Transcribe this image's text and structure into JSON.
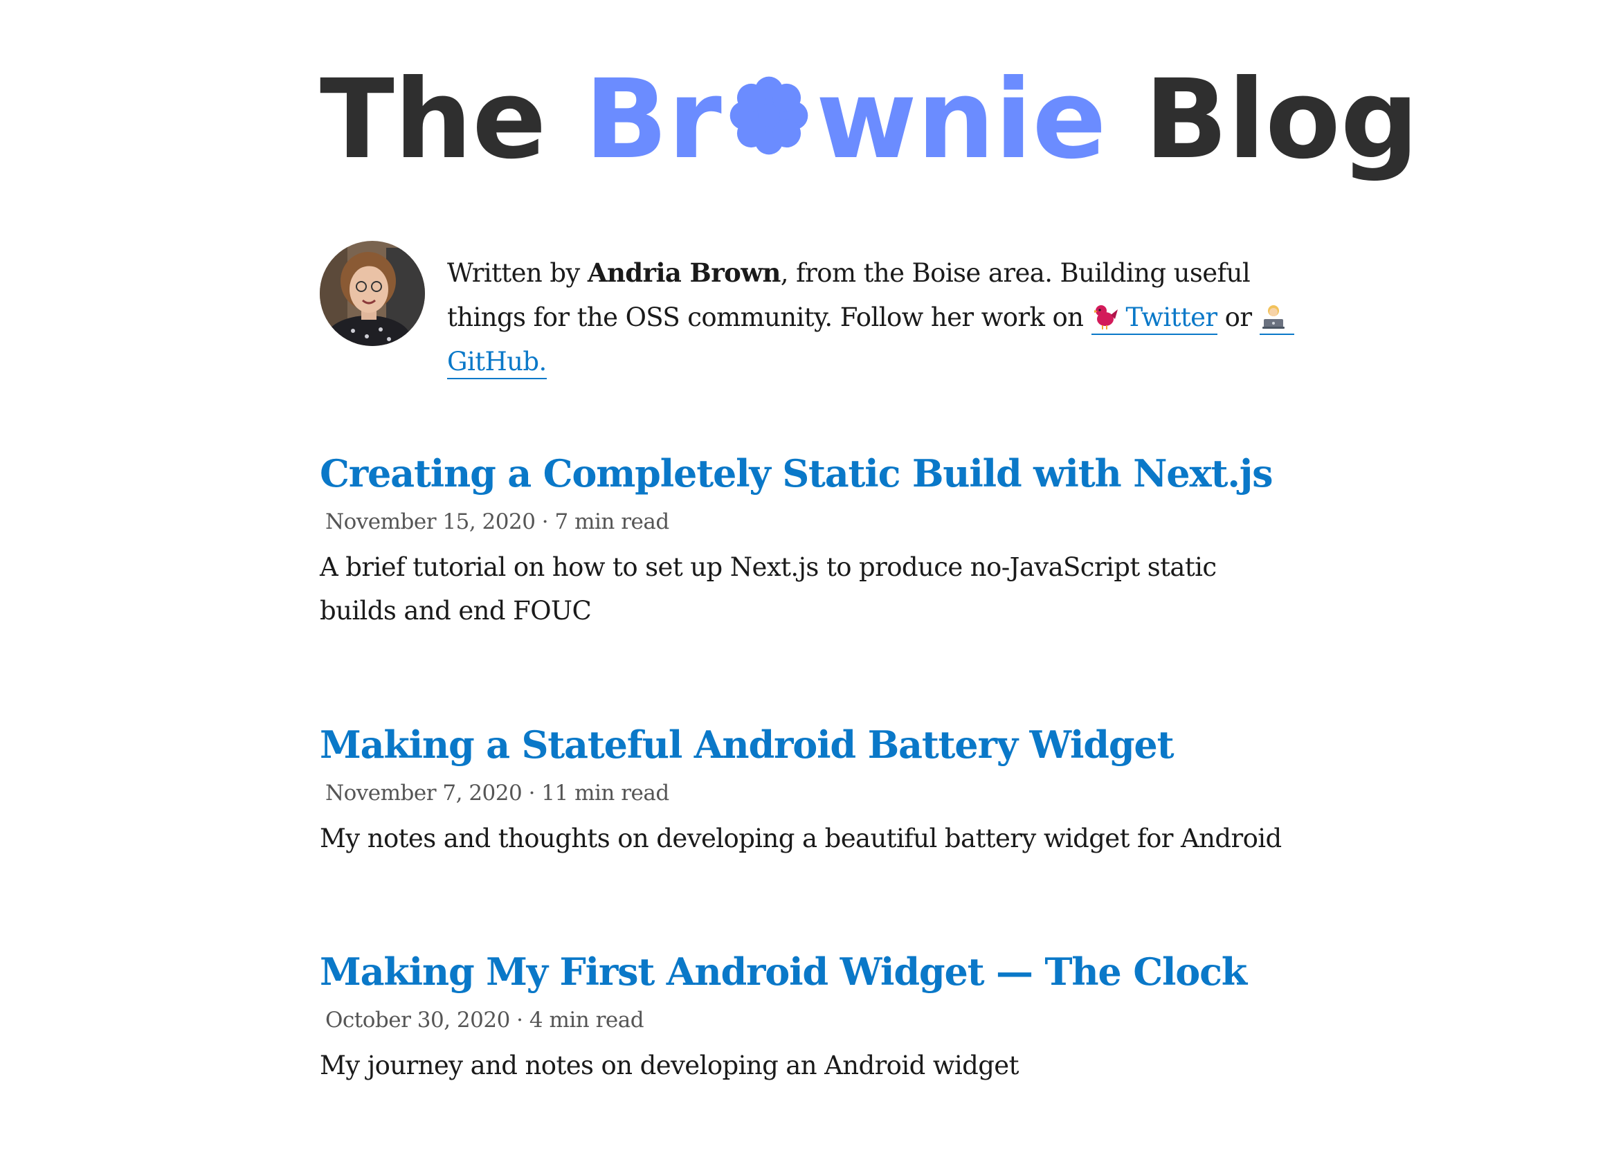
{
  "colors": {
    "accent": "#6b8cff",
    "link": "#0a78c8",
    "title_dark": "#2f2f2f"
  },
  "header": {
    "title_the": "The",
    "title_br": "Br",
    "title_wnie": "wnie",
    "title_blog": "Blog"
  },
  "bio": {
    "prefix": "Written by ",
    "author": "Andria Brown",
    "middle": ", from the Boise area. Building useful things for the OSS community. Follow her work on ",
    "twitter_label": "Twitter",
    "twitter_icon": "bird-emoji",
    "or": " or ",
    "github_label": "GitHub.",
    "github_icon": "technologist-emoji"
  },
  "posts": [
    {
      "title": "Creating a Completely Static Build with Next.js",
      "date": "November 15, 2020",
      "read_time": "7 min read",
      "description": "A brief tutorial on how to set up Next.js to produce no-JavaScript static builds and end FOUC"
    },
    {
      "title": "Making a Stateful Android Battery Widget",
      "date": "November 7, 2020",
      "read_time": "11 min read",
      "description": "My notes and thoughts on developing a beautiful battery widget for Android"
    },
    {
      "title": "Making My First Android Widget — The Clock",
      "date": "October 30, 2020",
      "read_time": "4 min read",
      "description": "My journey and notes on developing an Android widget"
    }
  ],
  "meta_separator": " · "
}
